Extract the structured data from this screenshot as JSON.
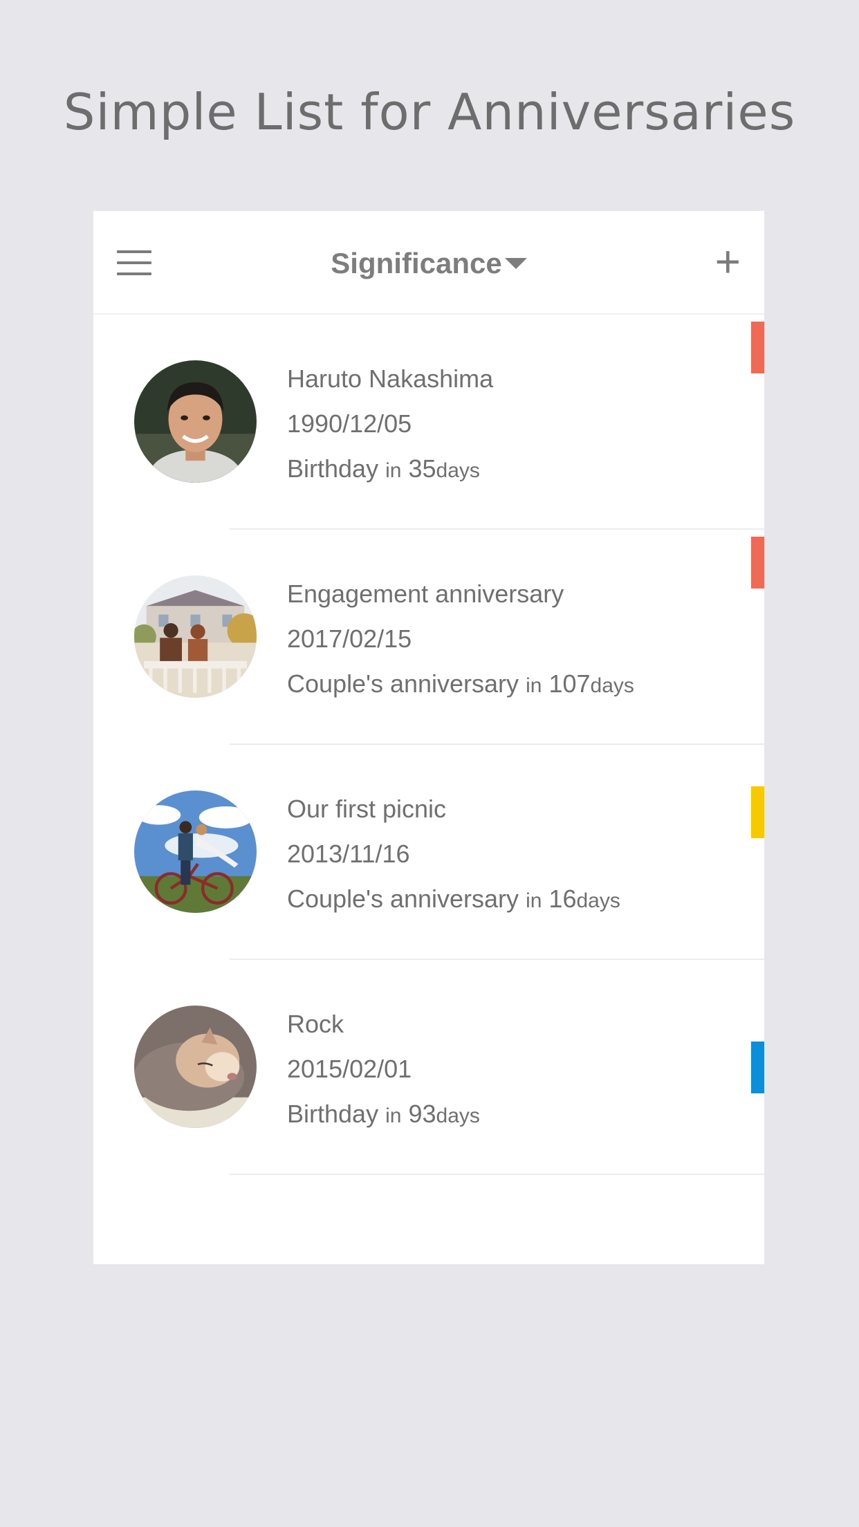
{
  "headline": "Simple List for Anniversaries",
  "appbar": {
    "menu_icon": "hamburger-menu-icon",
    "sort_label": "Significance",
    "sort_icon": "caret-down-icon",
    "add_label": "+"
  },
  "items": [
    {
      "name": "Haruto Nakashima",
      "date": "1990/12/05",
      "type": "Birthday",
      "in_word": "in",
      "days": "35",
      "days_word": "days",
      "tag_color": "#ee6a55",
      "tag_level": "top"
    },
    {
      "name": "Engagement anniversary",
      "date": "2017/02/15",
      "type": "Couple's anniversary",
      "in_word": "in",
      "days": "107",
      "days_word": "days",
      "tag_color": "#ee6a55",
      "tag_level": "top"
    },
    {
      "name": "Our first picnic",
      "date": "2013/11/16",
      "type": "Couple's anniversary",
      "in_word": "in",
      "days": "16",
      "days_word": "days",
      "tag_color": "#f7c900",
      "tag_level": "upper-middle"
    },
    {
      "name": "Rock",
      "date": "2015/02/01",
      "type": "Birthday",
      "in_word": "in",
      "days": "93",
      "days_word": "days",
      "tag_color": "#0d8ed8",
      "tag_level": "middle"
    }
  ]
}
